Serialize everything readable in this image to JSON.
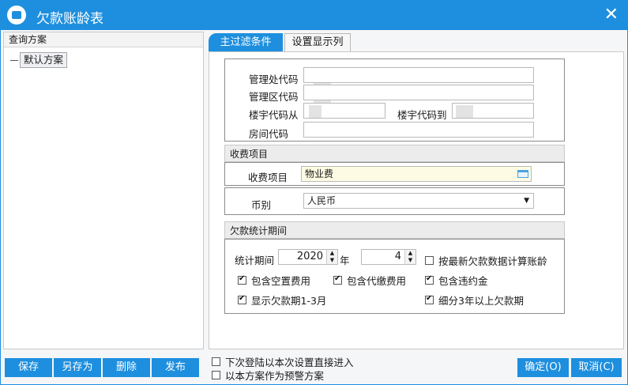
{
  "window": {
    "title": "欠款账龄表",
    "close_glyph": "✕"
  },
  "left": {
    "header": "查询方案",
    "tree_items": [
      {
        "label": "默认方案"
      }
    ]
  },
  "buttons": {
    "save": "保存",
    "save_as": "另存为",
    "delete": "删除",
    "publish": "发布",
    "ok": "确定(O)",
    "cancel": "取消(C)"
  },
  "bottom_options": {
    "direct_enter": "下次登陆以本次设置直接进入",
    "as_warning": "以本方案作为预警方案"
  },
  "tabs": {
    "main": "主过滤条件",
    "columns": "设置显示列"
  },
  "filter": {
    "mgmt_code_label": "管理处代码",
    "area_code_label": "管理区代码",
    "building_from_label": "楼宇代码从",
    "building_to_label": "楼宇代码到",
    "room_code_label": "房间代码"
  },
  "fee": {
    "section": "收费项目",
    "item_label": "收费项目",
    "item_value": "物业费",
    "currency_label": "币别",
    "currency_value": "人民币",
    "folder_icon": "folder-open-icon",
    "dropdown_glyph": "▼"
  },
  "period": {
    "section": "欠款统计期间",
    "label": "统计期间",
    "year": "2020",
    "year_unit": "年",
    "month": "4",
    "latest_calc": "按最新欠款数据计算账龄",
    "include_vacant": "包含空置费用",
    "include_agency": "包含代缴费用",
    "include_penalty": "包含违约金",
    "show_1_3": "显示欠款期1-3月",
    "detail_3y": "细分3年以上欠款期"
  },
  "colors": {
    "accent": "#1e8fde",
    "fee_highlight": "#fdfbe3"
  }
}
